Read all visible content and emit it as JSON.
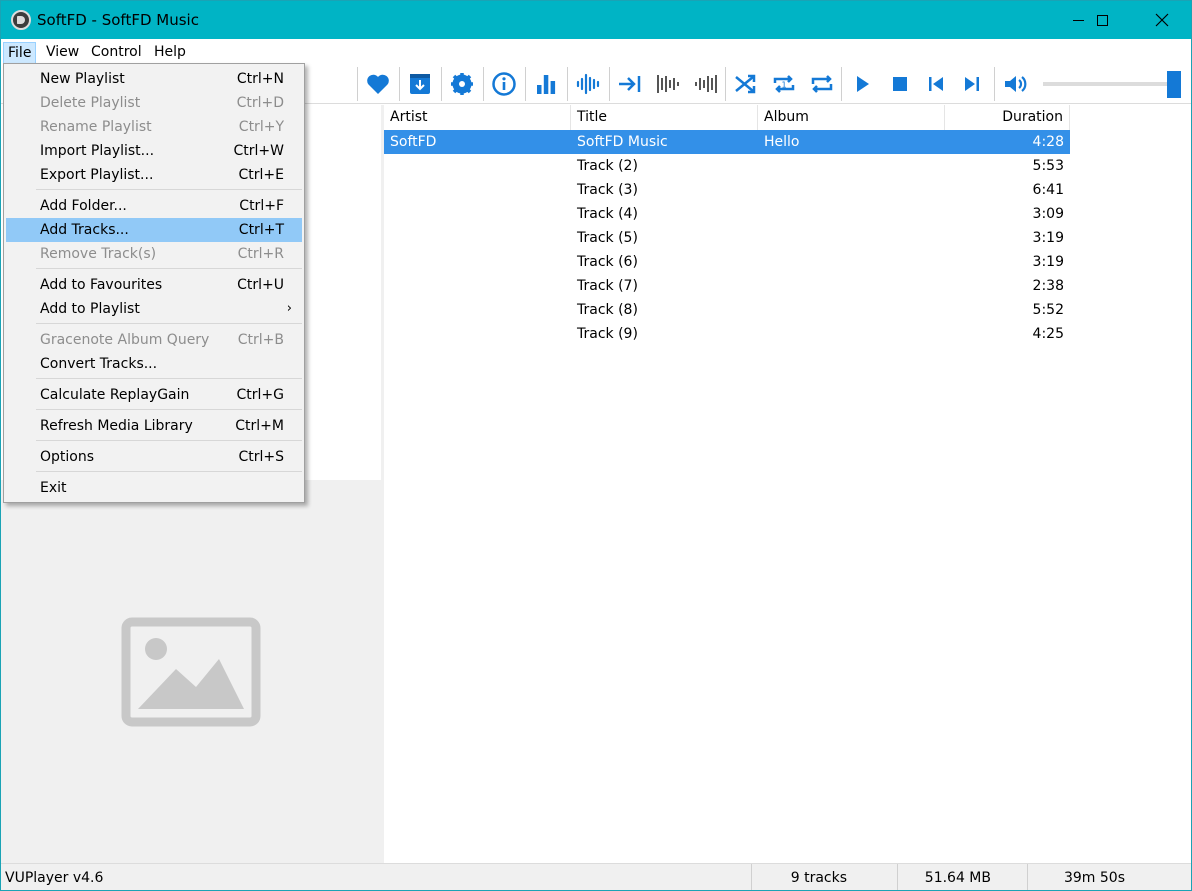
{
  "window": {
    "title": "SoftFD - SoftFD Music"
  },
  "menubar": {
    "file": "File",
    "view": "View",
    "control": "Control",
    "help": "Help"
  },
  "file_menu": {
    "items": [
      {
        "label": "New Playlist",
        "shortcut": "Ctrl+N"
      },
      {
        "label": "Delete Playlist",
        "shortcut": "Ctrl+D"
      },
      {
        "label": "Rename Playlist",
        "shortcut": "Ctrl+Y"
      },
      {
        "label": "Import Playlist...",
        "shortcut": "Ctrl+W"
      },
      {
        "label": "Export Playlist...",
        "shortcut": "Ctrl+E"
      },
      {
        "label": "Add Folder...",
        "shortcut": "Ctrl+F"
      },
      {
        "label": "Add Tracks...",
        "shortcut": "Ctrl+T"
      },
      {
        "label": "Remove Track(s)",
        "shortcut": "Ctrl+R"
      },
      {
        "label": "Add to Favourites",
        "shortcut": "Ctrl+U"
      },
      {
        "label": "Add to Playlist",
        "shortcut": ""
      },
      {
        "label": "Gracenote Album Query",
        "shortcut": "Ctrl+B"
      },
      {
        "label": "Convert Tracks...",
        "shortcut": ""
      },
      {
        "label": "Calculate ReplayGain",
        "shortcut": "Ctrl+G"
      },
      {
        "label": "Refresh Media Library",
        "shortcut": "Ctrl+M"
      },
      {
        "label": "Options",
        "shortcut": "Ctrl+S"
      },
      {
        "label": "Exit",
        "shortcut": ""
      }
    ],
    "submenu_arrow": "›"
  },
  "toolbar": {
    "icons": [
      "heart-icon",
      "download-icon",
      "gear-icon",
      "info-icon",
      "bar-chart-icon",
      "waveform-icon",
      "skip-to-end-icon",
      "waveform-left-icon",
      "waveform-right-icon",
      "shuffle-icon",
      "repeat-one-icon",
      "repeat-all-icon",
      "play-icon",
      "stop-icon",
      "previous-icon",
      "next-icon",
      "volume-icon"
    ],
    "accent_color": "#1479d6",
    "volume_level": 1.0
  },
  "tracklist": {
    "columns": {
      "artist": "Artist",
      "title": "Title",
      "album": "Album",
      "duration": "Duration"
    },
    "rows": [
      {
        "artist": "SoftFD",
        "title": "SoftFD Music",
        "album": "Hello",
        "duration": "4:28",
        "selected": true
      },
      {
        "artist": "",
        "title": "Track (2)",
        "album": "",
        "duration": "5:53"
      },
      {
        "artist": "",
        "title": "Track (3)",
        "album": "",
        "duration": "6:41"
      },
      {
        "artist": "",
        "title": "Track (4)",
        "album": "",
        "duration": "3:09"
      },
      {
        "artist": "",
        "title": "Track (5)",
        "album": "",
        "duration": "3:19"
      },
      {
        "artist": "",
        "title": "Track (6)",
        "album": "",
        "duration": "3:19"
      },
      {
        "artist": "",
        "title": "Track (7)",
        "album": "",
        "duration": "2:38"
      },
      {
        "artist": "",
        "title": "Track (8)",
        "album": "",
        "duration": "5:52"
      },
      {
        "artist": "",
        "title": "Track (9)",
        "album": "",
        "duration": "4:25"
      }
    ]
  },
  "statusbar": {
    "version": "VUPlayer v4.6",
    "tracks": "9 tracks",
    "size": "51.64 MB",
    "duration": "39m 50s"
  },
  "colors": {
    "titlebar": "#00b4c5",
    "selection": "#3390e8",
    "menu_highlight": "#91c9f7"
  }
}
